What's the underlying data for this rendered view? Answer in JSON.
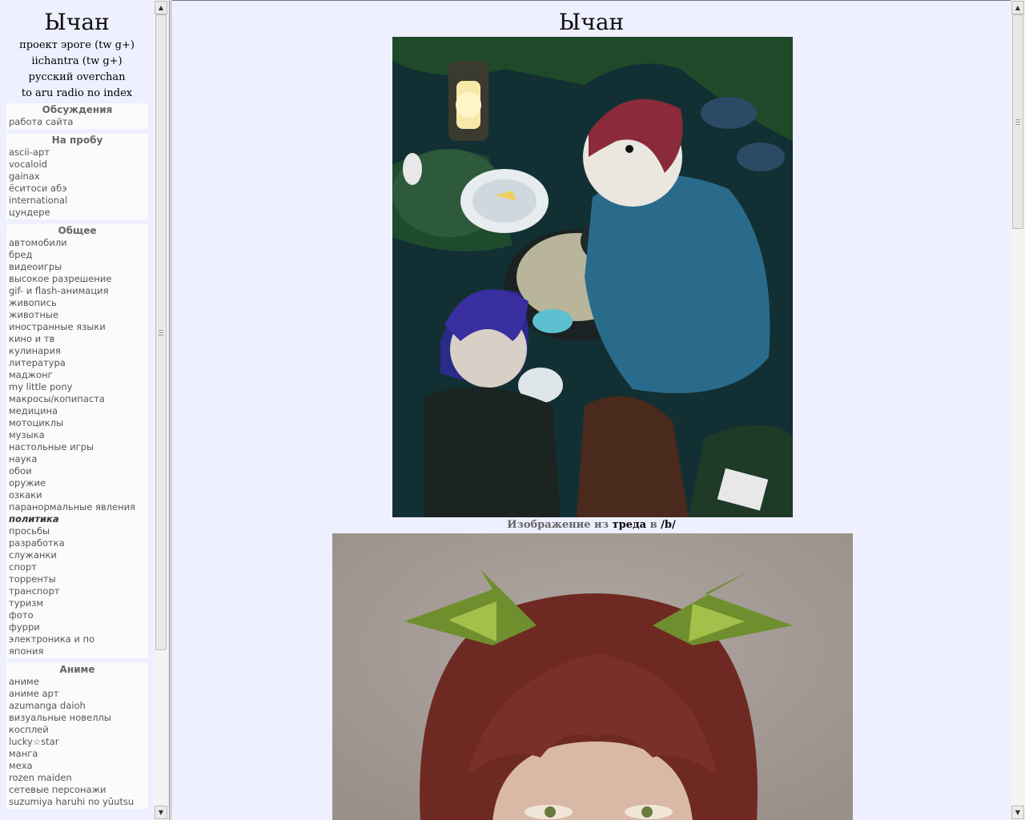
{
  "site": {
    "title": "Ычан",
    "links": [
      "проект эроге (tw g+)",
      "iichantra (tw g+)",
      "русский overchan",
      "to aru radio no index"
    ]
  },
  "sections": [
    {
      "title": "Обсуждения",
      "items": [
        "работа сайта"
      ]
    },
    {
      "title": "На пробу",
      "items": [
        "ascii-арт",
        "vocaloid",
        "gainax",
        "ёситоси абэ",
        "international",
        "цундере"
      ]
    },
    {
      "title": "Общее",
      "items": [
        "автомобили",
        "бред",
        "видеоигры",
        "высокое разрешение",
        "gif- и flash-анимация",
        "живопись",
        "животные",
        "иностранные языки",
        "кино и тв",
        "кулинария",
        "литература",
        "маджонг",
        "my little pony",
        "макросы/копипаста",
        "медицина",
        "мотоциклы",
        "музыка",
        "настольные игры",
        "наука",
        "обои",
        "оружие",
        "озкаки",
        "паранормальные явления",
        "политика",
        "просьбы",
        "разработка",
        "служанки",
        "спорт",
        "торренты",
        "транспорт",
        "туризм",
        "фото",
        "фурри",
        "электроника и по",
        "япония"
      ]
    },
    {
      "title": "Аниме",
      "items": [
        "аниме",
        "аниме арт",
        "azumanga daioh",
        "визуальные новеллы",
        "косплей",
        "lucky☆star",
        "манга",
        "меха",
        "rozen maiden",
        "сетевые персонажи",
        "suzumiya haruhi no yūutsu"
      ]
    }
  ],
  "current_item": "политика",
  "main": {
    "title": "Ычан",
    "caption_prefix": "Изображение из ",
    "caption_link": "треда",
    "caption_mid": " в ",
    "caption_board": "/b/"
  },
  "colors": {
    "frame_bg": "#eef0ff",
    "section_bg": "#fbfbfb",
    "link_gray": "#555555"
  },
  "icons": {
    "scroll_up": "arrow-up-icon",
    "scroll_down": "arrow-down-icon"
  }
}
